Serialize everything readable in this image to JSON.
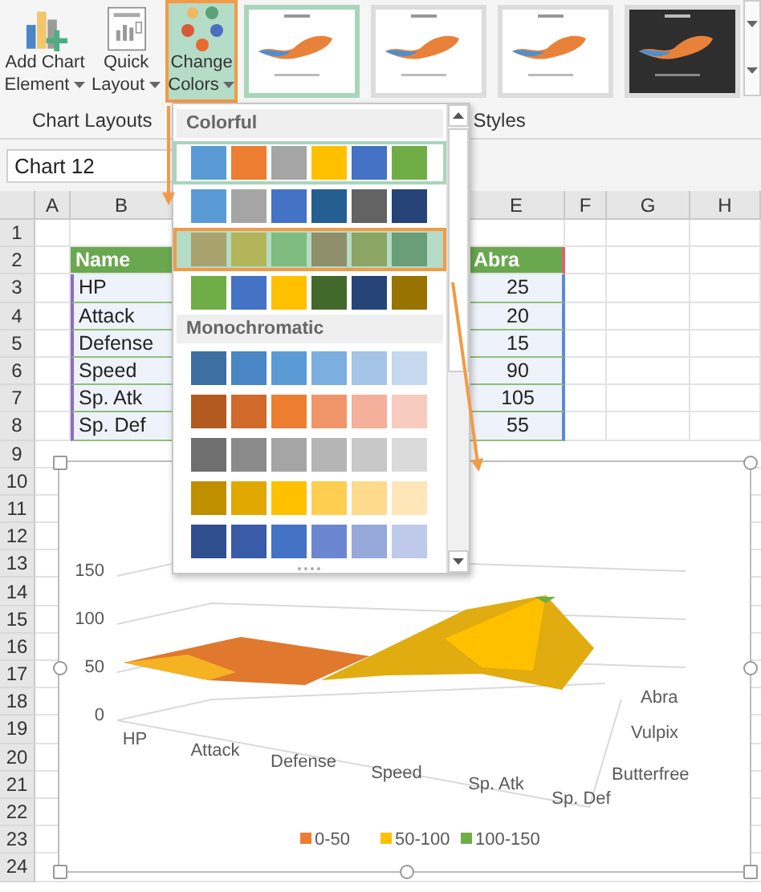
{
  "ribbon": {
    "buttons": [
      {
        "kind": "add-element",
        "lines": [
          "Add Chart",
          "Element"
        ],
        "selected": false
      },
      {
        "kind": "quick-layout",
        "lines": [
          "Quick",
          "Layout"
        ],
        "selected": false
      },
      {
        "kind": "change-colors",
        "lines": [
          "Change",
          "Colors"
        ],
        "selected": true
      }
    ],
    "style_thumbnails": [
      {
        "kind": "light",
        "selected": true
      },
      {
        "kind": "light",
        "selected": false
      },
      {
        "kind": "light",
        "selected": false
      },
      {
        "kind": "dark",
        "selected": false
      }
    ],
    "groups": [
      "Chart Layouts",
      "Styles"
    ]
  },
  "name_box": "Chart 12",
  "columns": [
    "A",
    "B",
    "E",
    "F",
    "G",
    "H"
  ],
  "rows": [
    "1",
    "2",
    "3",
    "4",
    "5",
    "6",
    "7",
    "8",
    "9",
    "10",
    "11",
    "12",
    "13",
    "14",
    "15",
    "16",
    "17",
    "18",
    "19",
    "20",
    "21",
    "22",
    "23",
    "24"
  ],
  "table": {
    "header": [
      "Name",
      "Abra"
    ],
    "rows": [
      [
        "HP",
        "25"
      ],
      [
        "Attack",
        "20"
      ],
      [
        "Defense",
        "15"
      ],
      [
        "Speed",
        "90"
      ],
      [
        "Sp. Atk",
        "105"
      ],
      [
        "Sp. Def",
        "55"
      ]
    ]
  },
  "color_menu": {
    "sections": [
      {
        "title": "Colorful",
        "palettes": [
          {
            "current": true,
            "highlighted": false,
            "swatches": [
              {
                "color": "#5b9bd5"
              },
              {
                "color": "#ed7d31"
              },
              {
                "color": "#a5a5a5"
              },
              {
                "color": "#ffc000"
              },
              {
                "color": "#4472c4"
              },
              {
                "color": "#70ad47"
              }
            ]
          },
          {
            "current": false,
            "highlighted": false,
            "swatches": [
              {
                "color": "#5b9bd5"
              },
              {
                "color": "#a5a5a5"
              },
              {
                "color": "#4472c4"
              },
              {
                "color": "#255e91"
              },
              {
                "color": "#636363"
              },
              {
                "color": "#264478"
              }
            ]
          },
          {
            "current": false,
            "highlighted": true,
            "swatches": [
              {
                "color": "#a9a26e"
              },
              {
                "color": "#b3b55a"
              },
              {
                "color": "#7fbc7f"
              },
              {
                "color": "#8e8e6a"
              },
              {
                "color": "#8aa564"
              },
              {
                "color": "#6a9e78"
              }
            ]
          },
          {
            "current": false,
            "highlighted": false,
            "swatches": [
              {
                "color": "#70ad47"
              },
              {
                "color": "#4472c4"
              },
              {
                "color": "#ffc000"
              },
              {
                "color": "#43682b"
              },
              {
                "color": "#264478"
              },
              {
                "color": "#997300"
              }
            ]
          }
        ]
      },
      {
        "title": "Monochromatic",
        "palettes": [
          {
            "current": false,
            "highlighted": false,
            "swatches": [
              {
                "color": "#3e6fa3"
              },
              {
                "color": "#4a85c5"
              },
              {
                "color": "#5b9bd5"
              },
              {
                "color": "#7daee0"
              },
              {
                "color": "#a5c4e8"
              },
              {
                "color": "#c5d8ee"
              }
            ]
          },
          {
            "current": false,
            "highlighted": false,
            "swatches": [
              {
                "color": "#b35a20"
              },
              {
                "color": "#d0692a"
              },
              {
                "color": "#ed7d31"
              },
              {
                "color": "#f0956a"
              },
              {
                "color": "#f4b09a"
              },
              {
                "color": "#f7cbbf"
              }
            ]
          },
          {
            "current": false,
            "highlighted": false,
            "swatches": [
              {
                "color": "#6f6f6f"
              },
              {
                "color": "#8a8a8a"
              },
              {
                "color": "#a5a5a5"
              },
              {
                "color": "#b5b5b5"
              },
              {
                "color": "#c8c8c8"
              },
              {
                "color": "#dadada"
              }
            ]
          },
          {
            "current": false,
            "highlighted": false,
            "swatches": [
              {
                "color": "#bf8f00"
              },
              {
                "color": "#e0a800"
              },
              {
                "color": "#ffc000"
              },
              {
                "color": "#ffcd50"
              },
              {
                "color": "#ffd98c"
              },
              {
                "color": "#ffe5b8"
              }
            ]
          },
          {
            "current": false,
            "highlighted": false,
            "swatches": [
              {
                "color": "#2f4f8f"
              },
              {
                "color": "#3a5ba8"
              },
              {
                "color": "#4472c4"
              },
              {
                "color": "#6b86d0"
              },
              {
                "color": "#97a8da"
              },
              {
                "color": "#bfcaea"
              }
            ]
          }
        ]
      }
    ]
  },
  "chart": {
    "y_ticks": [
      "150",
      "100",
      "50",
      "0"
    ],
    "categories": [
      "HP",
      "Attack",
      "Defense",
      "Speed",
      "Sp. Atk",
      "Sp. Def"
    ],
    "series": [
      "Abra",
      "Vulpix",
      "Butterfree"
    ],
    "legend": [
      {
        "label": "0-50",
        "color": "#ed7d31"
      },
      {
        "label": "50-100",
        "color": "#ffc000"
      },
      {
        "label": "100-150",
        "color": "#70ad47"
      }
    ]
  }
}
